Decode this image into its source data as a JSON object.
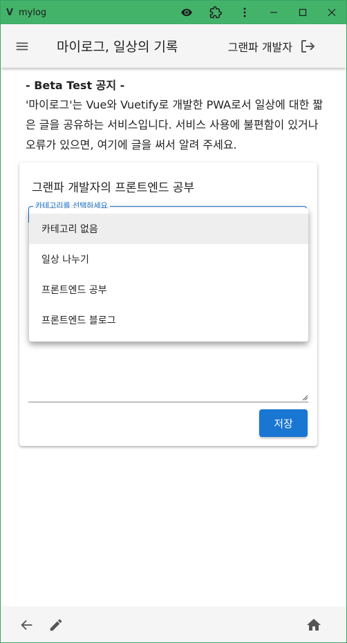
{
  "window": {
    "logo_text": "V",
    "title": "mylog"
  },
  "appbar": {
    "title": "마이로그, 일상의 기록",
    "user_name": "그랜파 개발자"
  },
  "notice": {
    "title": "- Beta Test 공지 -",
    "body": "'마이로그'는 Vue와 Vuetify로 개발한 PWA로서 일상에 대한 짧은 글을 공유하는 서비스입니다. 서비스 사용에 불편함이 있거나 오류가 있으면, 여기에 글을 써서 알려 주세요."
  },
  "card": {
    "title": "그랜파 개발자의 프론트엔드 공부",
    "select_label": "카테고리를 선택하세요",
    "save_label": "저장"
  },
  "dropdown": {
    "items": [
      {
        "label": "카테고리 없음"
      },
      {
        "label": "일상 나누기"
      },
      {
        "label": "프론트엔드 공부"
      },
      {
        "label": "프론트엔드 블로그"
      }
    ]
  },
  "colors": {
    "titlebar": "#44b36a",
    "primary": "#1976d2"
  },
  "icons": [
    "eye-icon",
    "extension-icon",
    "more-vert-icon",
    "minimize-icon",
    "maximize-icon",
    "close-icon",
    "menu-icon",
    "logout-icon",
    "arrow-back-icon",
    "pencil-icon",
    "home-icon"
  ]
}
